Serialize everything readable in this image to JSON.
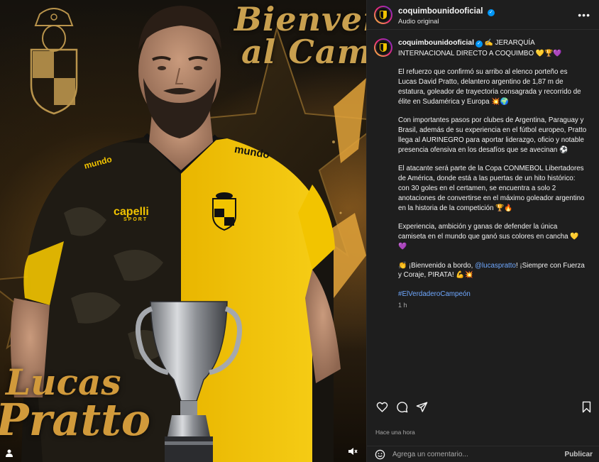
{
  "media": {
    "headline_line1": "Bienvenido",
    "headline_line2": "al Campeón",
    "player_first_name": "Lucas",
    "player_last_name": "Pratto",
    "sponsor_chest": "capelli",
    "sponsor_chest_sub": "SPORT",
    "sponsor_shoulder": "mundo"
  },
  "header": {
    "username": "coquimbounidooficial",
    "audio": "Audio original",
    "more_icon": "more-horizontal-icon"
  },
  "caption": {
    "username": "coquimbounidooficial",
    "intro": " ✍️ JERARQUÍA INTERNACIONAL DIRECTO A COQUIMBO 💛🏆💜",
    "paragraphs": [
      "El refuerzo que confirmó su arribo al elenco porteño es Lucas David Pratto, delantero argentino de 1,87 m de estatura, goleador de trayectoria consagrada y recorrido de élite en Sudamérica y Europa 💥🌍",
      "Con importantes pasos por clubes de Argentina, Paraguay y Brasil, además de su experiencia en el fútbol europeo, Pratto llega al AURINEGRO para aportar liderazgo, oficio y notable presencia ofensiva en los desafíos que se avecinan ⚽",
      "El atacante será parte de la Copa CONMEBOL Libertadores de América, donde está a las puertas de un hito histórico: con 30 goles en el certamen, se encuentra a solo 2 anotaciones de convertirse en el máximo goleador argentino en la historia de la competición 🏆🔥",
      "Experiencia, ambición y ganas de defender la única camiseta en el mundo que ganó sus colores en cancha 💛💜"
    ],
    "welcome_before": "👏 ¡Bienvenido a bordo, ",
    "welcome_mention": "@lucaspratto",
    "welcome_after": "! ¡Siempre con Fuerza y Coraje, PIRATA! 💪💥",
    "hashtag": "#ElVerdaderoCampeón",
    "time_ago": "1 h"
  },
  "actions": {
    "like_icon": "heart-icon",
    "comment_icon": "comment-icon",
    "share_icon": "share-icon",
    "save_icon": "bookmark-icon"
  },
  "posted_time": "Hace una hora",
  "comment": {
    "placeholder": "Agrega un comentario...",
    "publish_label": "Publicar"
  },
  "colors": {
    "panel_bg": "#1e1e1e",
    "link": "#6fa8ff",
    "gold": "#c9a04f",
    "jersey_yellow": "#f2c400",
    "verified_blue": "#0095f6"
  }
}
